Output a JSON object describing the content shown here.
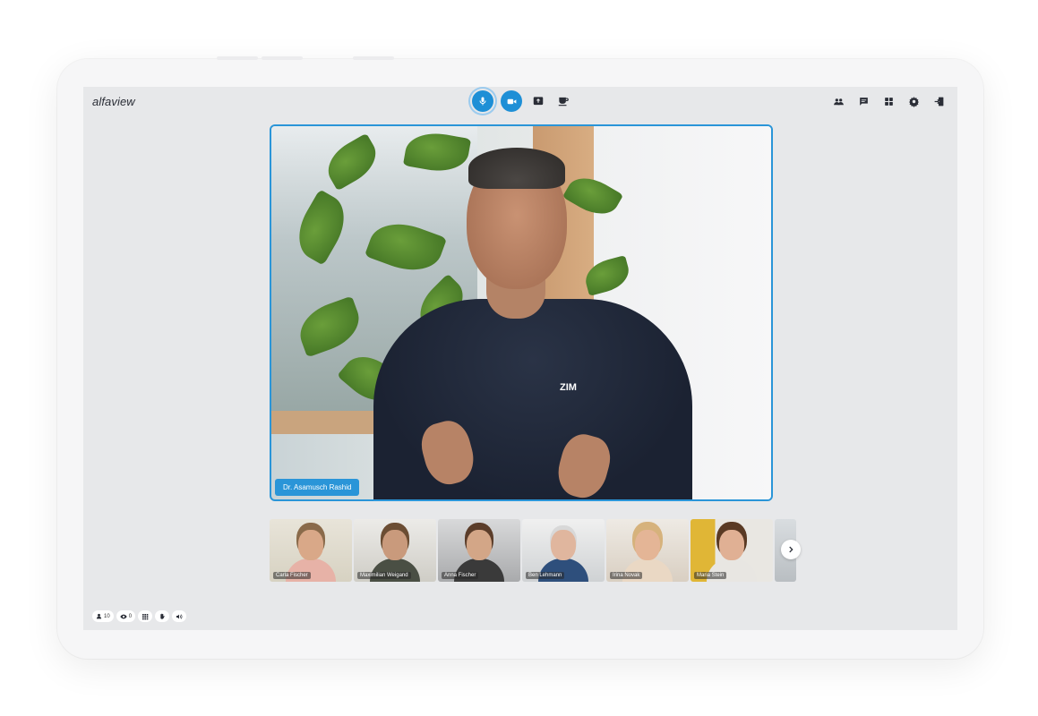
{
  "app": {
    "name": "alfaview"
  },
  "colors": {
    "accent": "#1e8fd6",
    "screen_bg": "#e7e8ea",
    "icon": "#2a2d36"
  },
  "toolbar": {
    "center": [
      {
        "icon": "microphone-icon",
        "state": "active"
      },
      {
        "icon": "video-camera-icon",
        "state": "on"
      },
      {
        "icon": "screen-share-icon"
      },
      {
        "icon": "coffee-break-icon"
      }
    ],
    "right": [
      {
        "icon": "participants-icon"
      },
      {
        "icon": "chat-icon"
      },
      {
        "icon": "layout-grid-icon"
      },
      {
        "icon": "settings-gear-icon"
      },
      {
        "icon": "leave-room-icon"
      }
    ]
  },
  "main_video": {
    "speaker_name": "Dr. Asamusch Rashid",
    "shirt_text": "ZIM"
  },
  "participants": [
    {
      "name": "Carla Fischer"
    },
    {
      "name": "Maximilian Weigand"
    },
    {
      "name": "Anna Fischer"
    },
    {
      "name": "Ben Lehmann"
    },
    {
      "name": "Irina Novak"
    },
    {
      "name": "Maria Stein"
    }
  ],
  "statusbar": {
    "participant_count": "10",
    "viewer_count": "0"
  }
}
